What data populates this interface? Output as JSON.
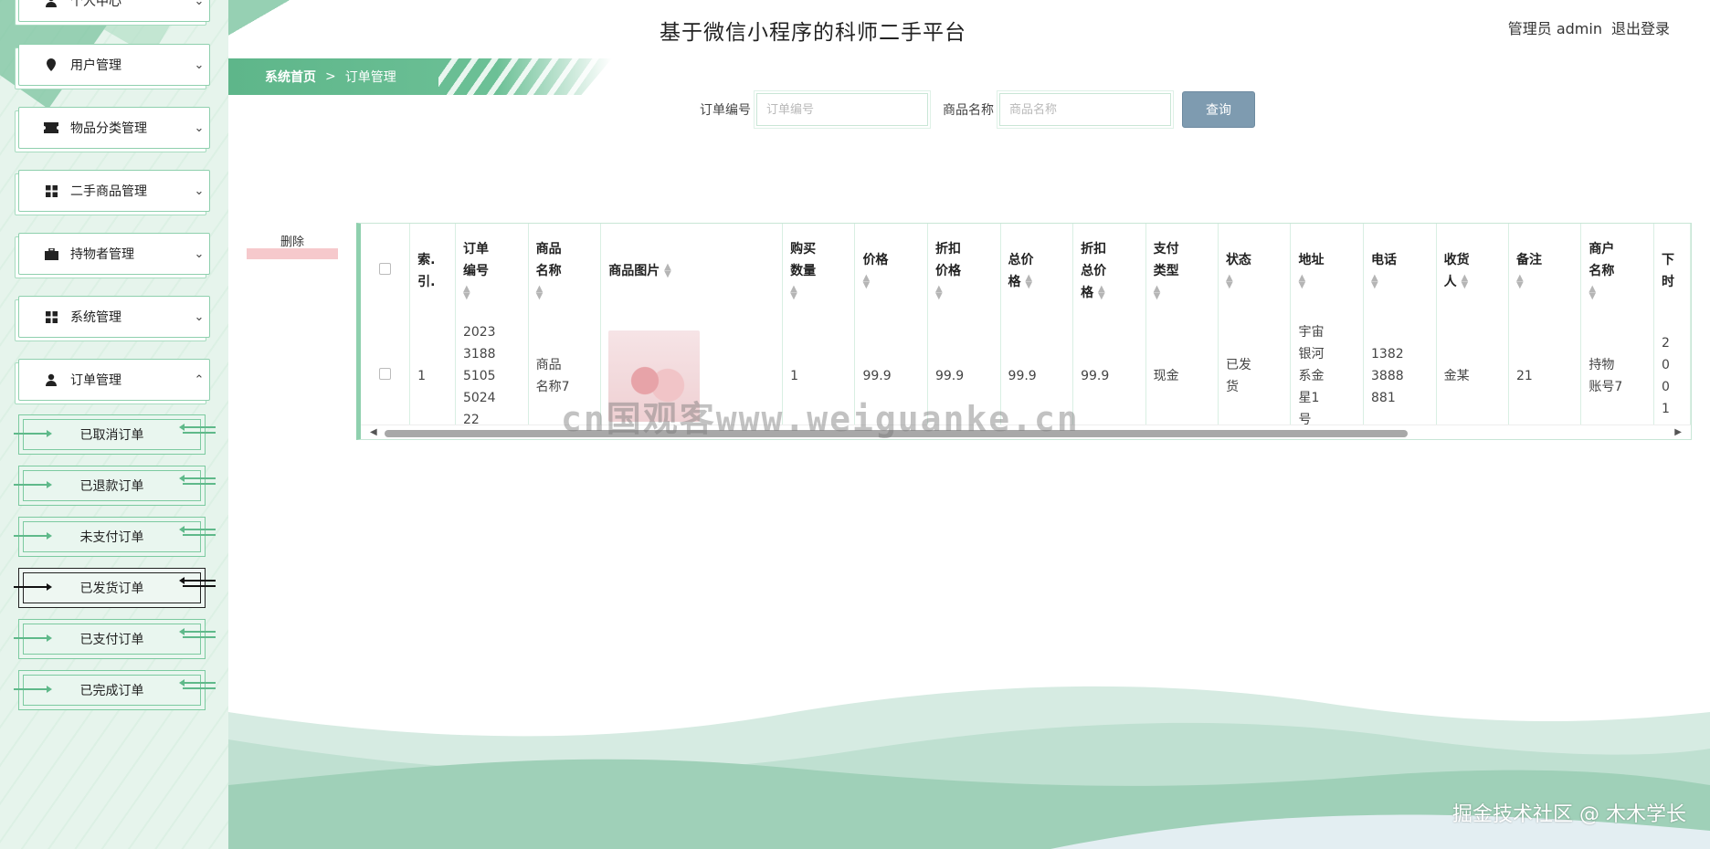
{
  "header": {
    "title": "基于微信小程序的科师二手平台",
    "user_label": "管理员 admin",
    "logout": "退出登录"
  },
  "sidebar": {
    "items": [
      {
        "label": "个人中心",
        "icon": "user-icon"
      },
      {
        "label": "用户管理",
        "icon": "map-pin-icon"
      },
      {
        "label": "物品分类管理",
        "icon": "ticket-icon"
      },
      {
        "label": "二手商品管理",
        "icon": "grid-icon"
      },
      {
        "label": "持物者管理",
        "icon": "briefcase-icon"
      },
      {
        "label": "系统管理",
        "icon": "grid-icon"
      },
      {
        "label": "订单管理",
        "icon": "user-icon"
      }
    ],
    "sub_items": [
      {
        "label": "已取消订单"
      },
      {
        "label": "已退款订单"
      },
      {
        "label": "未支付订单"
      },
      {
        "label": "已发货订单",
        "active": true
      },
      {
        "label": "已支付订单"
      },
      {
        "label": "已完成订单"
      }
    ]
  },
  "breadcrumb": {
    "home": "系统首页",
    "separator": ">",
    "current": "订单管理"
  },
  "search": {
    "order_no_label": "订单编号",
    "order_no_placeholder": "订单编号",
    "goods_name_label": "商品名称",
    "goods_name_placeholder": "商品名称",
    "query_button": "查询"
  },
  "actions": {
    "delete": "删除"
  },
  "table": {
    "headers": [
      "索.\n引.",
      "订单\n编号",
      "商品\n名称",
      "商品图片",
      "购买\n数量",
      "价格",
      "折扣\n价格",
      "总价\n格",
      "折扣\n总价\n格",
      "支付\n类型",
      "状态",
      "地址",
      "电话",
      "收货\n人",
      "备注",
      "商户\n名称",
      "下\n时"
    ],
    "rows": [
      {
        "index": "1",
        "order_no": "202331885105502422",
        "goods_name": "商品名称7",
        "quantity": "1",
        "price": "99.9",
        "discount_price": "99.9",
        "total": "99.9",
        "discount_total": "99.9",
        "pay_type": "现金",
        "status": "已发货",
        "address": "宇宙银河系金星1号",
        "phone": "13823888881",
        "receiver": "金某",
        "note": "21",
        "merchant": "持物账号7",
        "time_partial": "2\n0\n0\n1"
      }
    ]
  },
  "watermark": "cn国观客www.weiguanke.cn",
  "credit": "掘金技术社区 @ 木木学长",
  "colors": {
    "accent": "#5eb68a",
    "sidebar_bg": "#e6f4ec",
    "button": "#7e9bb0"
  }
}
